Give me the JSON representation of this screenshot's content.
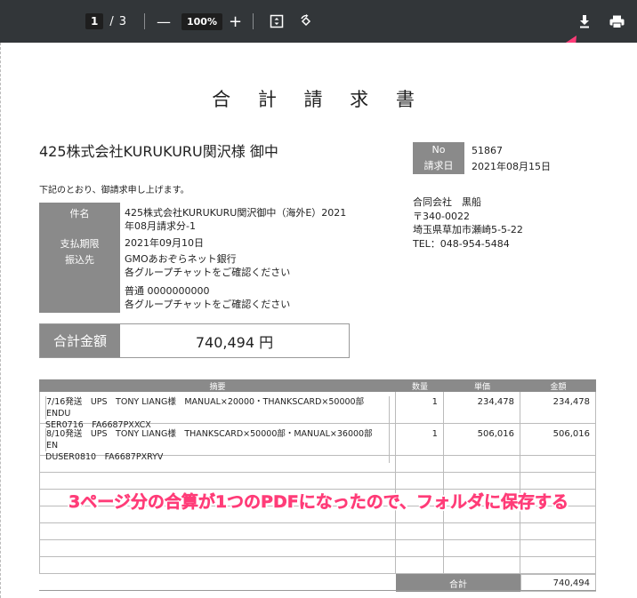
{
  "toolbar": {
    "current_page": "1",
    "page_separator": "/",
    "total_pages": "3",
    "zoom": "100%",
    "zoom_out": "—",
    "zoom_in": "+"
  },
  "invoice": {
    "title": "合 計 請 求 書",
    "customer": "425株式会社KURUKURU関沢様 御中",
    "greeting": "下記のとおり、御請求申し上げます。",
    "meta": {
      "no_label": "No",
      "no_value": "51867",
      "date_label": "請求日",
      "date_value": "2021年08月15日"
    },
    "company": {
      "name": "合同会社　黒船",
      "zip": "〒340-0022",
      "address": "埼玉県草加市瀬崎5-5-22",
      "tel": "TEL：048-954-5484"
    },
    "info": {
      "subject_label": "件名",
      "subject_line1": "425株式会社KURUKURU関沢御中（海外E）2021",
      "subject_line2": "年08月請求分-1",
      "due_label": "支払期限",
      "due_value": "2021年09月10日",
      "bank_label": "振込先",
      "bank_line1": "GMOあおぞらネット銀行",
      "bank_line2": "各グループチャットをご確認ください",
      "account_line1": "普通 0000000000",
      "account_line2": "各グループチャットをご確認ください"
    },
    "total_label": "合計金額",
    "total_value": "740,494 円",
    "items_header": [
      "摘要",
      "数量",
      "単価",
      "金額"
    ],
    "items": [
      {
        "desc_line1": "7/16発送　UPS　TONY LIANG様　MANUAL×20000・THANKSCARD×50000部　ENDU",
        "desc_line2": "SER0716　FA6687PXXCX",
        "qty": "1",
        "unit": "234,478",
        "amount": "234,478"
      },
      {
        "desc_line1": "8/10発送　UPS　TONY LIANG様　THANKSCARD×50000部・MANUAL×36000部　EN",
        "desc_line2": "DUSER0810　FA6687PXRYV",
        "qty": "1",
        "unit": "506,016",
        "amount": "506,016"
      }
    ],
    "sum_label": "合計",
    "sum_value": "740,494"
  },
  "annotation": {
    "text": "3ページ分の合算が1つのPDFになったので、フォルダに保存する",
    "color": "#ff3c78"
  }
}
